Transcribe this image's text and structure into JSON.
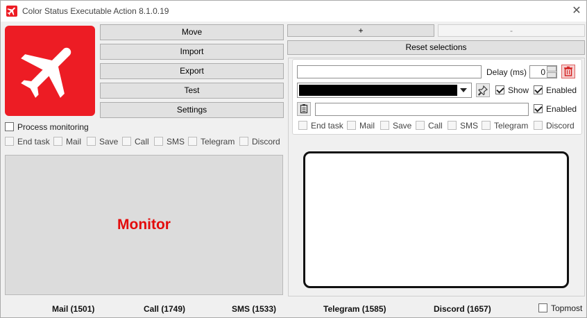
{
  "window": {
    "title": "Color Status Executable Action 8.1.0.19"
  },
  "left": {
    "buttons": {
      "move": "Move",
      "import": "Import",
      "export": "Export",
      "test": "Test",
      "settings": "Settings"
    },
    "process_monitoring": "Process monitoring",
    "options": [
      "End task",
      "Mail",
      "Save",
      "Call",
      "SMS",
      "Telegram",
      "Discord"
    ],
    "monitor_label": "Monitor"
  },
  "right": {
    "add_label": "+",
    "remove_label": "-",
    "reset_label": "Reset selections",
    "delay_label": "Delay (ms)",
    "delay_value": "0",
    "show_label": "Show",
    "enabled_label": "Enabled",
    "enabled2_label": "Enabled",
    "options": [
      "End task",
      "Mail",
      "Save",
      "Call",
      "SMS",
      "Telegram",
      "Discord"
    ]
  },
  "status": {
    "mail": "Mail (1501)",
    "call": "Call (1749)",
    "sms": "SMS (1533)",
    "telegram": "Telegram (1585)",
    "discord": "Discord (1657)",
    "topmost": "Topmost"
  },
  "colors": {
    "accent": "#ed1c24",
    "monitor_text": "#e30b0b",
    "selected_color": "#000000"
  }
}
